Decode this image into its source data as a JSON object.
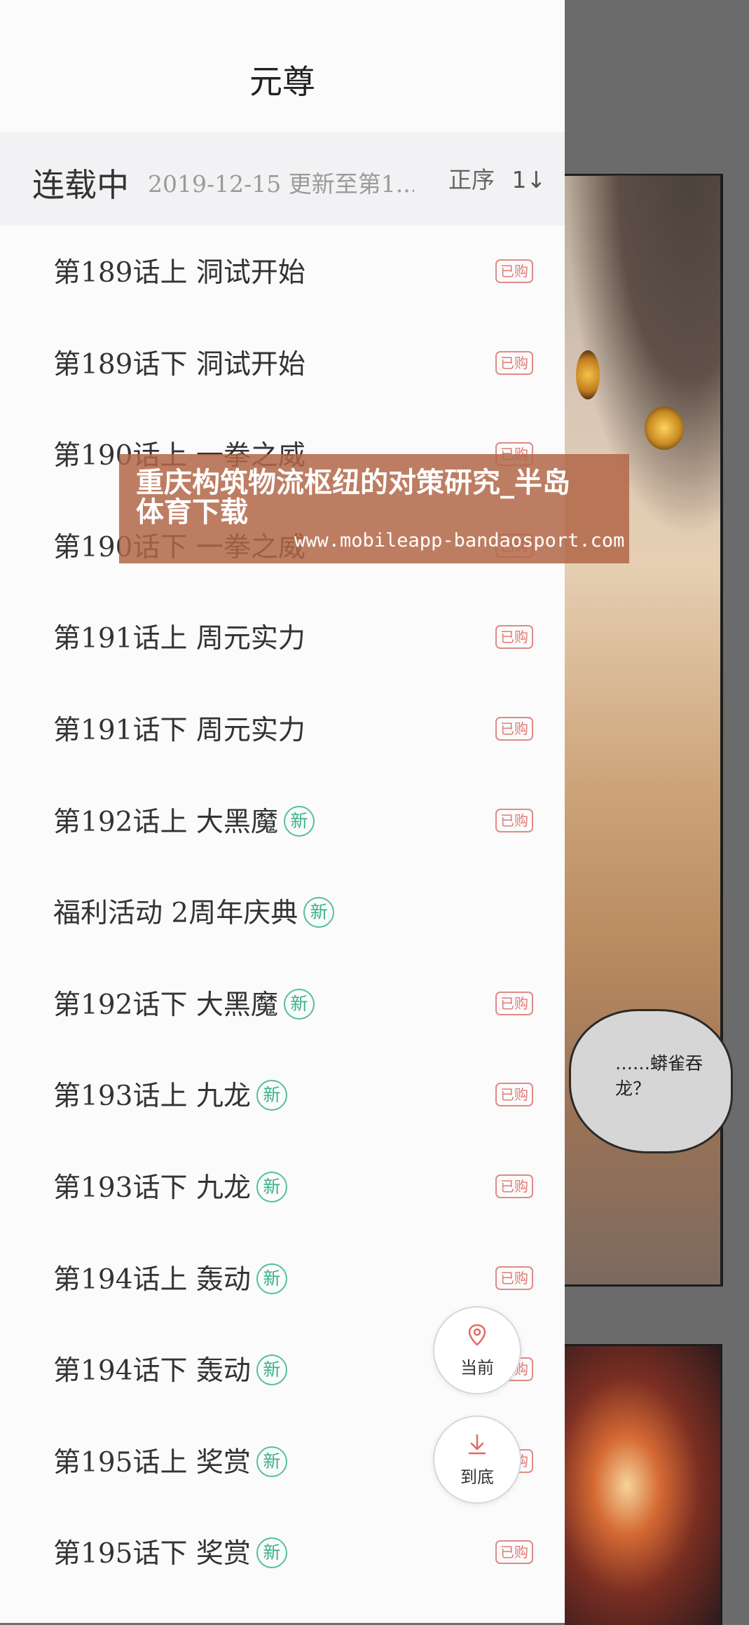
{
  "header": {
    "title": "元尊"
  },
  "status": {
    "label": "连载中",
    "update_text": "2019-12-15 更新至第1...",
    "order_label": "正序",
    "order_icon": "1↓"
  },
  "chapters": [
    {
      "name": "第189话上 洞试开始",
      "new": false,
      "bought": true
    },
    {
      "name": "第189话下 洞试开始",
      "new": false,
      "bought": true
    },
    {
      "name": "第190话上 一拳之威",
      "new": false,
      "bought": true
    },
    {
      "name": "第190话下 一拳之威",
      "new": false,
      "bought": true
    },
    {
      "name": "第191话上 周元实力",
      "new": false,
      "bought": true
    },
    {
      "name": "第191话下 周元实力",
      "new": false,
      "bought": true
    },
    {
      "name": "第192话上 大黑魔",
      "new": true,
      "bought": true
    },
    {
      "name": "福利活动 2周年庆典",
      "new": true,
      "bought": false
    },
    {
      "name": "第192话下 大黑魔",
      "new": true,
      "bought": true
    },
    {
      "name": "第193话上 九龙",
      "new": true,
      "bought": true
    },
    {
      "name": "第193话下 九龙",
      "new": true,
      "bought": true
    },
    {
      "name": "第194话上 轰动",
      "new": true,
      "bought": true
    },
    {
      "name": "第194话下 轰动",
      "new": true,
      "bought": true
    },
    {
      "name": "第195话上 奖赏",
      "new": true,
      "bought": true
    },
    {
      "name": "第195话下 奖赏",
      "new": true,
      "bought": true
    }
  ],
  "badges": {
    "new_label": "新",
    "bought_label": "已购"
  },
  "fab": {
    "current_label": "当前",
    "current_icon": "location-pin-icon",
    "bottom_label": "到底",
    "bottom_icon": "download-arrow-icon"
  },
  "comic": {
    "bubble_text": "……蟒雀吞龙？"
  },
  "watermark": {
    "title": "重庆构筑物流枢纽的对策研究_半岛体育下载",
    "url": "www.mobileapp-bandaosport.com"
  },
  "colors": {
    "new_badge": "#39b386",
    "bought_badge": "#e27a74",
    "drawer_bg": "#fbfbfc",
    "status_bg": "#f2f2f4"
  }
}
